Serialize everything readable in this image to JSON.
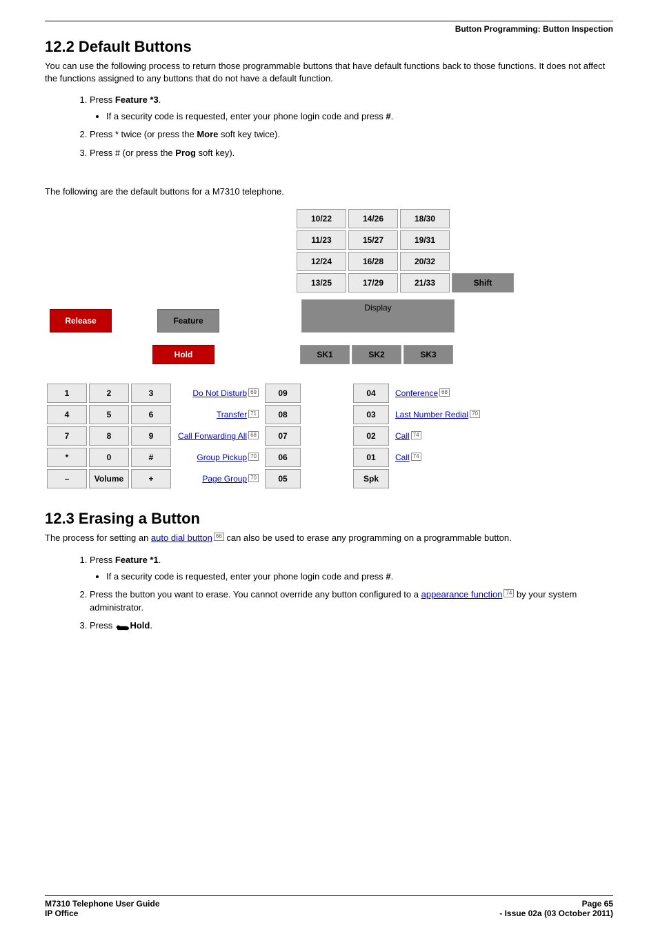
{
  "header": {
    "breadcrumb": "Button Programming: Button Inspection"
  },
  "section1": {
    "title": "12.2 Default Buttons",
    "intro": "You can use the following process to return those programmable buttons that have default functions back to those functions. It does not affect the functions assigned to any buttons that do not have a default function.",
    "step1_pre": "Press ",
    "step1_bold": "Feature *3",
    "step1_post": ".",
    "bullet1_pre": "If a security code is requested, enter your phone login code and press ",
    "bullet1_bold": "#",
    "bullet1_post": ".",
    "step2_pre": "Press * twice (or press the ",
    "step2_bold": "More",
    "step2_post": " soft key twice).",
    "step3_pre": "Press # (or press the ",
    "step3_bold": "Prog",
    "step3_post": " soft key).",
    "following_text": "The following are the default buttons for a M7310 telephone."
  },
  "phone": {
    "grid_top": [
      [
        "10/22",
        "14/26",
        "18/30"
      ],
      [
        "11/23",
        "15/27",
        "19/31"
      ],
      [
        "12/24",
        "16/28",
        "20/32"
      ],
      [
        "13/25",
        "17/29",
        "21/33"
      ]
    ],
    "shift": "Shift",
    "display": "Display",
    "release": "Release",
    "feature": "Feature",
    "hold": "Hold",
    "sk": [
      "SK1",
      "SK2",
      "SK3"
    ],
    "keypad": [
      [
        "1",
        "2",
        "3"
      ],
      [
        "4",
        "5",
        "6"
      ],
      [
        "7",
        "8",
        "9"
      ],
      [
        "*",
        "0",
        "#"
      ],
      [
        "–",
        "Volume",
        "+"
      ]
    ],
    "left_labels": [
      {
        "text": "Do Not Disturb",
        "ref": "69"
      },
      {
        "text": "Transfer",
        "ref": "71"
      },
      {
        "text": "Call Forwarding All",
        "ref": "68"
      },
      {
        "text": "Group Pickup",
        "ref": "70"
      },
      {
        "text": "Page Group",
        "ref": "70"
      }
    ],
    "col_left_nums": [
      "09",
      "08",
      "07",
      "06",
      "05"
    ],
    "col_right_nums": [
      "04",
      "03",
      "02",
      "01",
      "Spk"
    ],
    "right_labels": [
      {
        "text": "Conference",
        "ref": "68"
      },
      {
        "text": "Last Number Redial",
        "ref": "70"
      },
      {
        "text": "Call",
        "ref": "74"
      },
      {
        "text": "Call",
        "ref": "74"
      },
      {
        "text": "",
        "ref": ""
      }
    ]
  },
  "section2": {
    "title": "12.3 Erasing a Button",
    "intro_pre": "The process for setting an ",
    "intro_link": "auto dial button",
    "intro_ref": "66",
    "intro_post": " can also be used to erase any programming on a programmable button.",
    "step1_pre": "Press ",
    "step1_bold": "Feature *1",
    "step1_post": ".",
    "bullet1_pre": "If a security code is requested, enter your phone login code and press ",
    "bullet1_bold": "#",
    "bullet1_post": ".",
    "step2_pre": "Press the button you want to erase. You cannot override any button configured to a ",
    "step2_link": "appearance function",
    "step2_ref": "74",
    "step2_post": " by your system administrator.",
    "step3_pre": "Press ",
    "step3_bold": " Hold",
    "step3_post": "."
  },
  "footer": {
    "left1": "M7310 Telephone User Guide",
    "right1": "Page 65",
    "left2": "IP Office",
    "right2": "- Issue 02a (03 October 2011)"
  }
}
